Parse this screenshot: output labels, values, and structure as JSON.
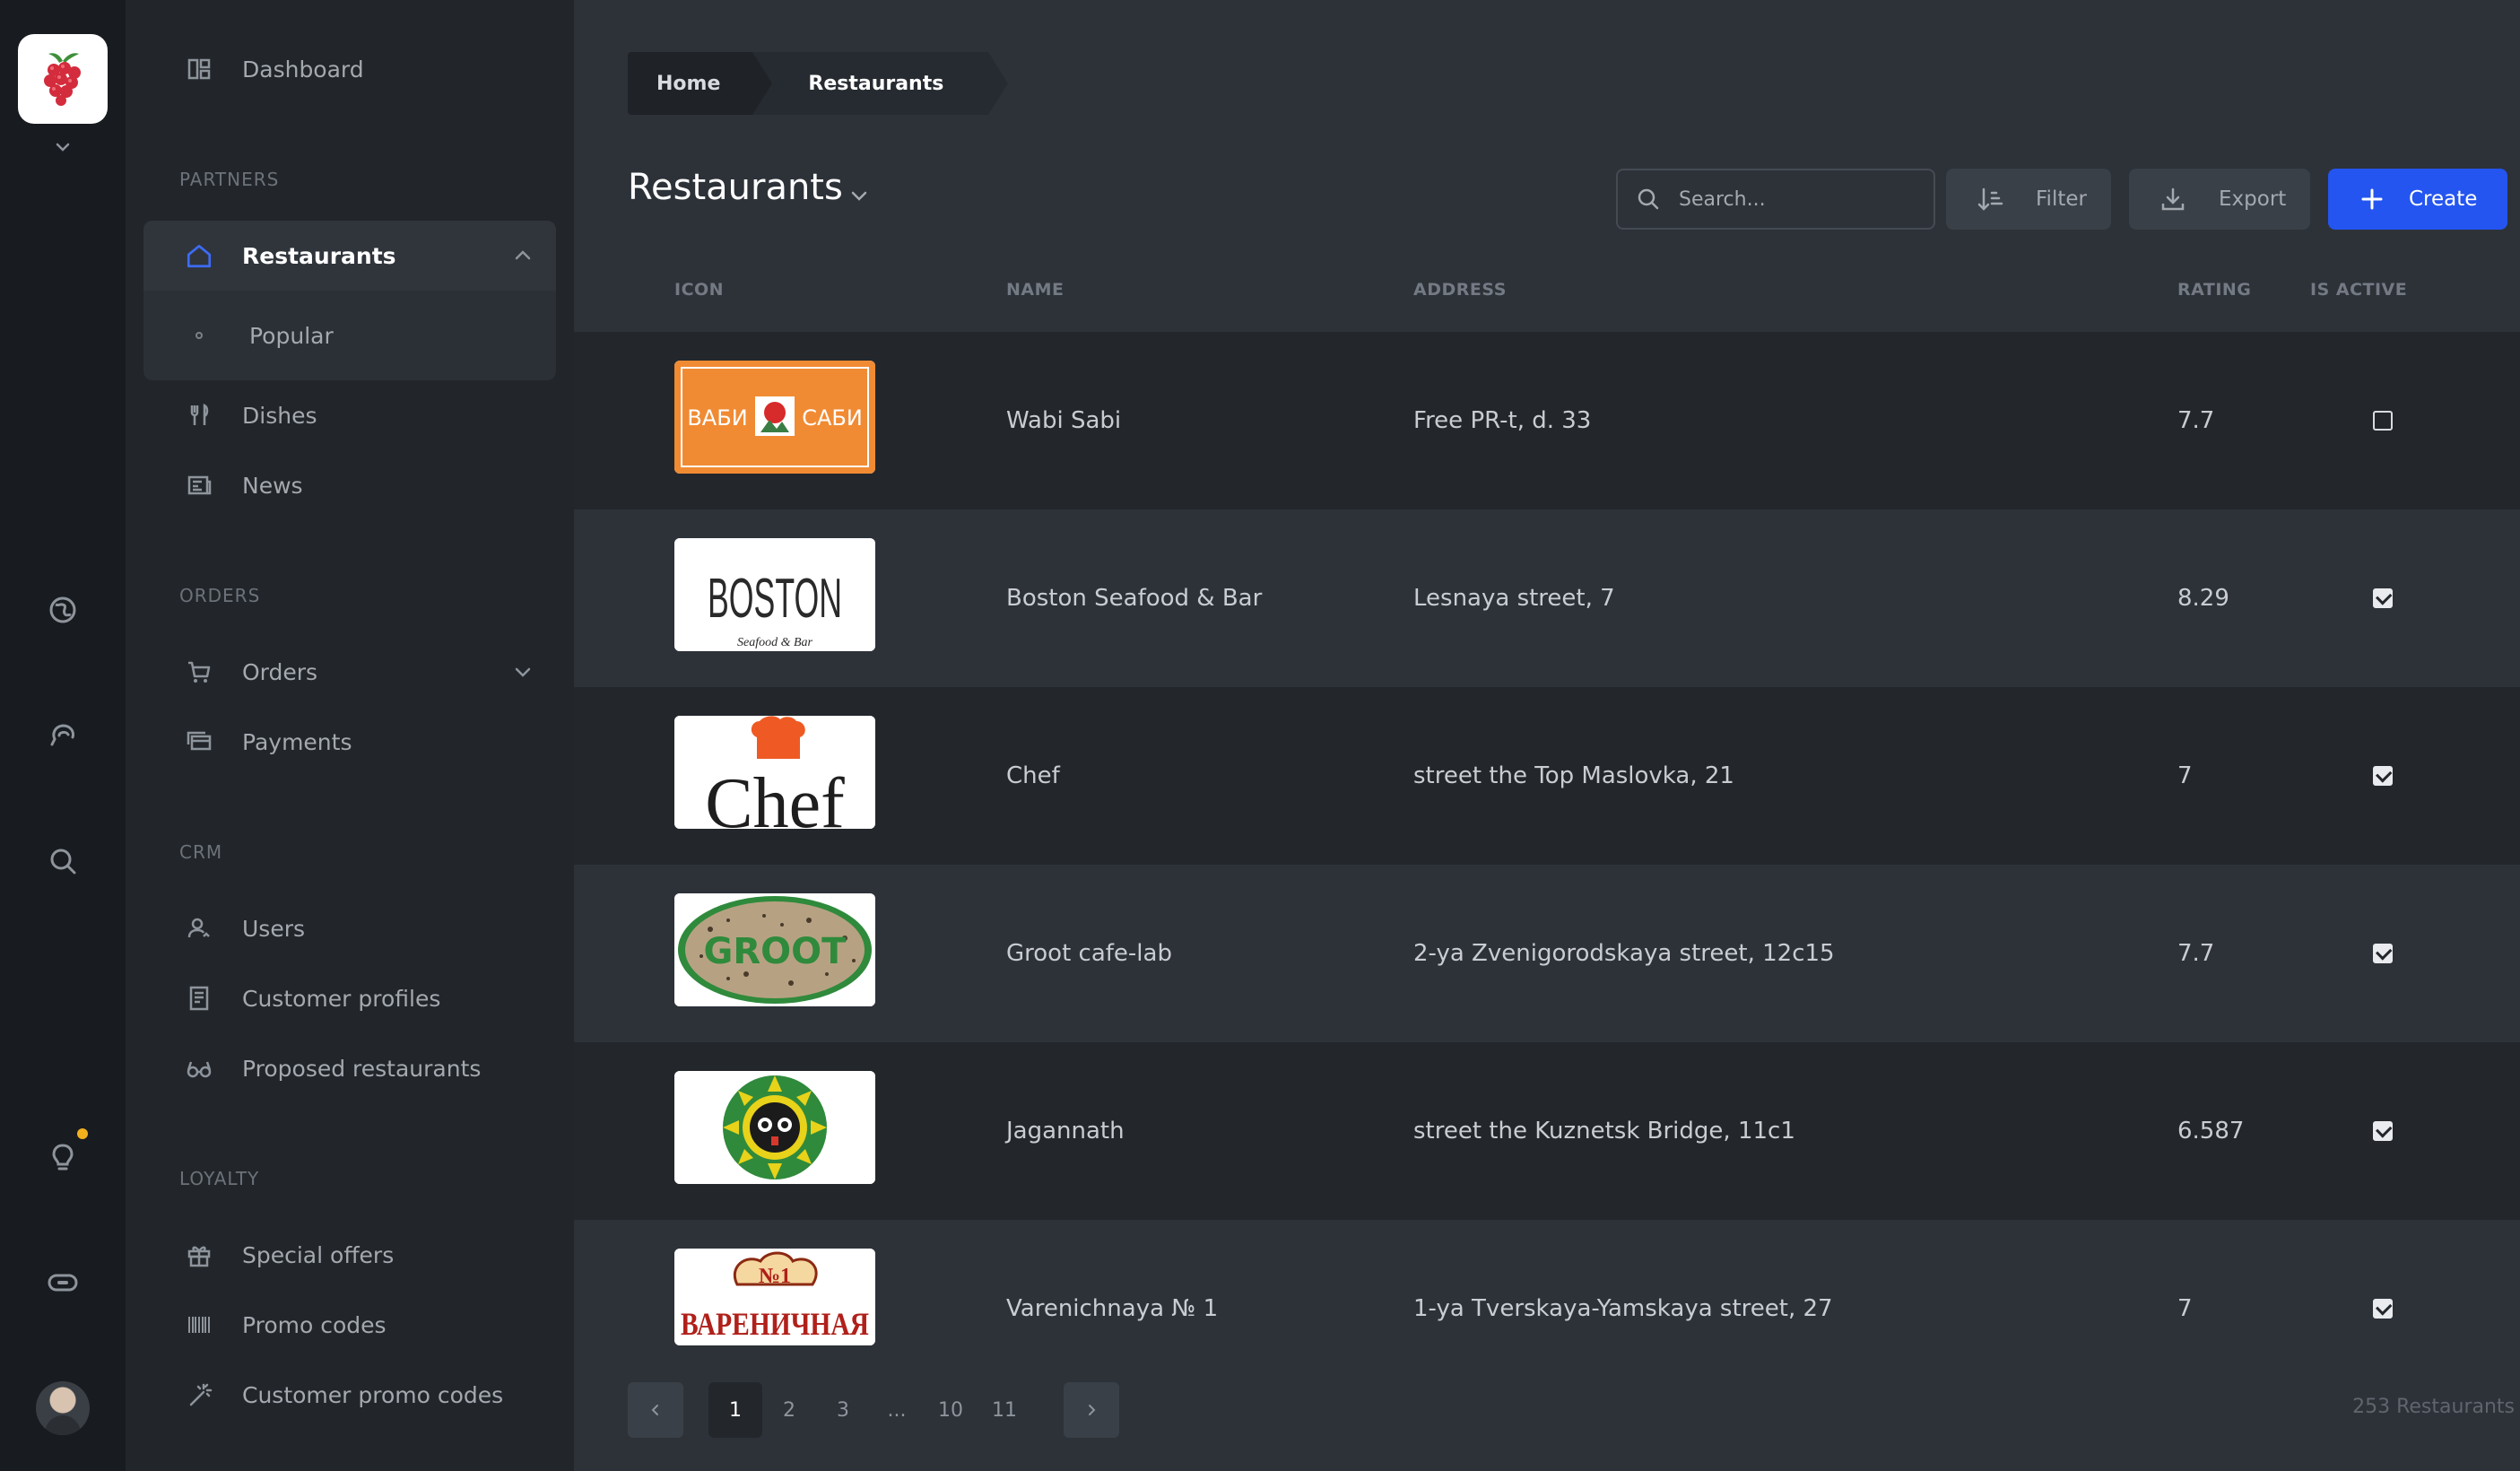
{
  "app": {
    "brand": "raspberry-logo"
  },
  "rail": {
    "icons": [
      "globe-icon",
      "chat-icon",
      "search-icon",
      "lightbulb-icon",
      "toggle-icon"
    ]
  },
  "sidebar": {
    "dashboard": "Dashboard",
    "sections": {
      "partners": "PARTNERS",
      "orders": "ORDERS",
      "crm": "CRM",
      "loyalty": "LOYALTY"
    },
    "restaurants": "Restaurants",
    "popular": "Popular",
    "dishes": "Dishes",
    "news": "News",
    "orders": "Orders",
    "payments": "Payments",
    "users": "Users",
    "customer_profiles": "Customer profiles",
    "proposed_restaurants": "Proposed restaurants",
    "special_offers": "Special offers",
    "promo_codes": "Promo codes",
    "customer_promo_codes": "Customer promo codes"
  },
  "breadcrumb": {
    "home": "Home",
    "current": "Restaurants"
  },
  "page": {
    "title": "Restaurants"
  },
  "toolbar": {
    "search_placeholder": "Search...",
    "filter": "Filter",
    "export": "Export",
    "create": "Create"
  },
  "table": {
    "columns": {
      "icon": "ICON",
      "name": "NAME",
      "address": "ADDRESS",
      "rating": "RATING",
      "is_active": "IS ACTIVE"
    },
    "rows": [
      {
        "name": "Wabi Sabi",
        "address": "Free PR-t, d. 33",
        "rating": "7.7",
        "active": false
      },
      {
        "name": "Boston Seafood & Bar",
        "address": "Lesnaya street, 7",
        "rating": "8.29",
        "active": true
      },
      {
        "name": "Chef",
        "address": "street the Top Maslovka, 21",
        "rating": "7",
        "active": true
      },
      {
        "name": "Groot cafe-lab",
        "address": "2-ya Zvenigorodskaya street, 12c15",
        "rating": "7.7",
        "active": true
      },
      {
        "name": "Jagannath",
        "address": "street the Kuznetsk Bridge, 11c1",
        "rating": "6.587",
        "active": true
      },
      {
        "name": "Varenichnaya № 1",
        "address": "1-ya Tverskaya-Yamskaya street, 27",
        "rating": "7",
        "active": true
      }
    ],
    "logos": {
      "wabi": {
        "left": "ВАБИ",
        "right": "САБИ"
      },
      "boston": {
        "text": "BOSTON",
        "sub": "Seafood & Bar"
      },
      "chef": {
        "text": "Chef"
      },
      "groot": {
        "text": "GROOT"
      },
      "varenichnaya": {
        "num": "№1",
        "text": "ВАРЕНИЧНАЯ"
      }
    }
  },
  "pagination": {
    "pages": [
      "1",
      "2",
      "3",
      "...",
      "10",
      "11"
    ],
    "current": "1",
    "total": "253 Restaurants"
  },
  "colors": {
    "accent": "#2455f0",
    "notification": "#f2b01e"
  }
}
